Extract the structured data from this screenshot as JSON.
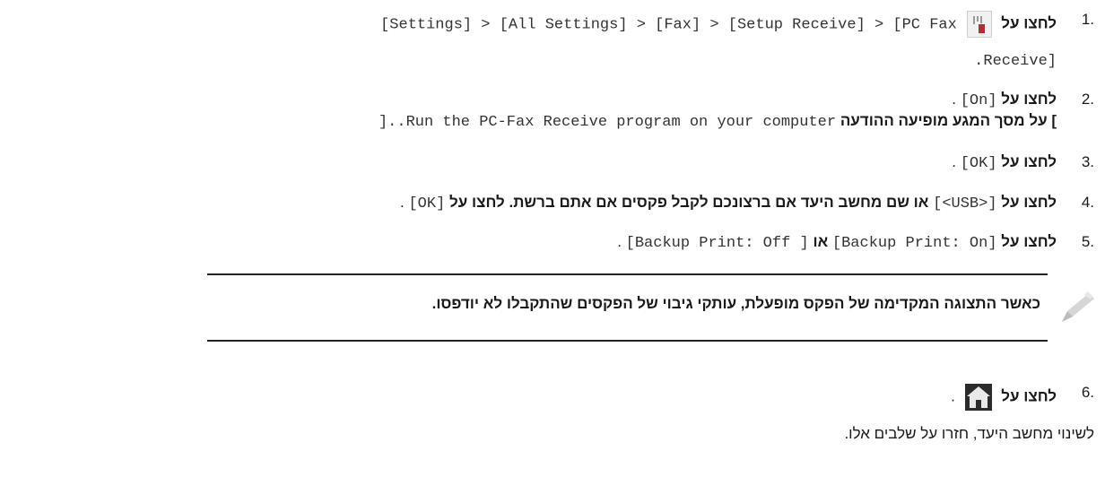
{
  "steps": [
    {
      "number": "1.",
      "action": "לחצו על",
      "path_en": "[Settings] > [All Settings] > [Fax] > [Setup Receive] > [PC Fax",
      "path_cont": ".Receive]",
      "icon": "settings-icon"
    },
    {
      "number": "2.",
      "action": "לחצו על",
      "value": "[On]",
      "value_suffix": ".",
      "sub_hebrew": "על מסך המגע מופיעה ההודעה [",
      "sub_en": ".Run the PC-Fax Receive program on your computer",
      "sub_suffix": "]."
    },
    {
      "number": "3.",
      "action": "לחצו על",
      "value": "[OK]",
      "value_suffix": "."
    },
    {
      "number": "4.",
      "action": "לחצו על",
      "value": "[<USB>]",
      "middle_hebrew": "או שם מחשב היעד אם ברצונכם לקבל פקסים אם אתם  ברשת. לחצו על",
      "value2": "[OK]",
      "value2_suffix": "."
    },
    {
      "number": "5.",
      "action": "לחצו על",
      "value": "[Backup Print: On]",
      "or_word": "או",
      "value2": "[Backup Print: Off ]",
      "value2_suffix": "."
    },
    {
      "number": "6.",
      "action": "לחצו על",
      "icon": "home-icon",
      "suffix": "."
    }
  ],
  "note": {
    "text": "כאשר התצוגה המקדימה של הפקס מופעלת, עותקי גיבוי של הפקסים שהתקבלו לא יודפסו.",
    "icon": "pencil-icon"
  },
  "footer": "לשינוי מחשב היעד, חזרו על שלבים אלו.",
  "colors": {
    "text": "#1a1a1a",
    "mono": "#333333",
    "rule": "#222222",
    "accent_red": "#c0282d"
  }
}
